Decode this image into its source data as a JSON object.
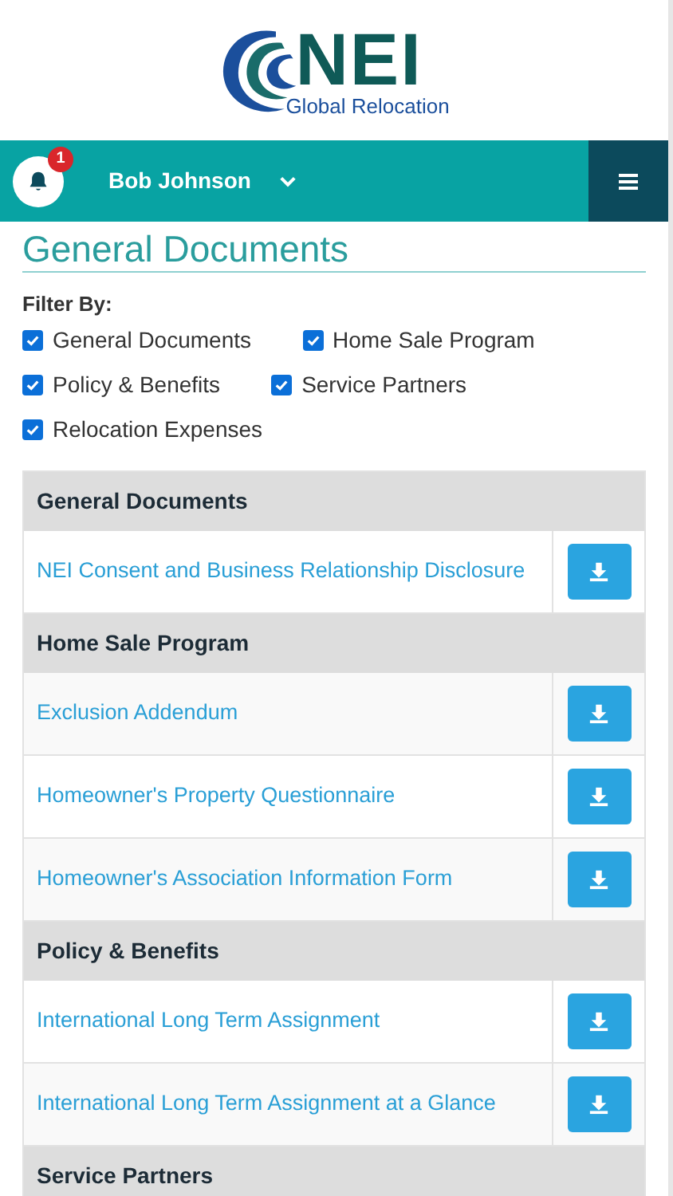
{
  "logo": {
    "mark": "NEI",
    "tagline": "Global Relocation"
  },
  "nav": {
    "notification_count": "1",
    "user_name": "Bob Johnson"
  },
  "page_title": "General Documents",
  "filter": {
    "label": "Filter By:",
    "options": [
      {
        "label": "General Documents",
        "checked": true
      },
      {
        "label": "Home Sale Program",
        "checked": true
      },
      {
        "label": "Policy & Benefits",
        "checked": true
      },
      {
        "label": "Service Partners",
        "checked": true
      },
      {
        "label": "Relocation Expenses",
        "checked": true
      }
    ]
  },
  "groups": [
    {
      "title": "General Documents",
      "documents": [
        "NEI Consent and Business Relationship Disclosure"
      ]
    },
    {
      "title": "Home Sale Program",
      "documents": [
        "Exclusion Addendum",
        "Homeowner's Property Questionnaire",
        "Homeowner's Association Information Form"
      ]
    },
    {
      "title": "Policy & Benefits",
      "documents": [
        "International Long Term Assignment",
        "International Long Term Assignment at a Glance"
      ]
    },
    {
      "title": "Service Partners"
    }
  ]
}
